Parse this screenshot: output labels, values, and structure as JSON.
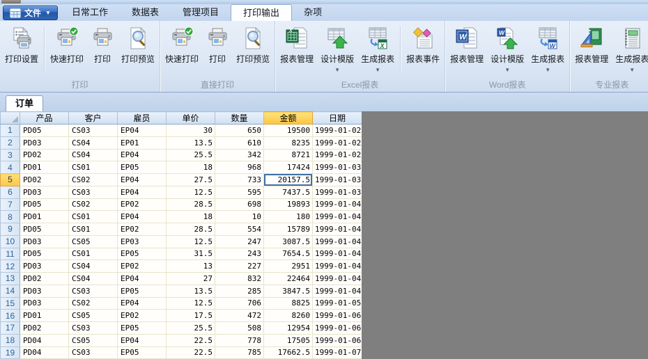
{
  "menu": {
    "file_button": {
      "label": "文件",
      "icon": "table-grid-icon",
      "caret": "▼"
    },
    "tabs": [
      {
        "name": "daily-work",
        "label": "日常工作",
        "active": false
      },
      {
        "name": "data-tables",
        "label": "数据表",
        "active": false
      },
      {
        "name": "manage-projects",
        "label": "管理项目",
        "active": false
      },
      {
        "name": "print-output",
        "label": "打印输出",
        "active": true
      },
      {
        "name": "misc",
        "label": "杂项",
        "active": false
      }
    ]
  },
  "ribbon": {
    "groups": [
      {
        "name": "print",
        "label": "打印",
        "buttons": [
          {
            "name": "print-settings",
            "label": "打印设置",
            "icon": "print-settings-icon",
            "dropdown": false,
            "divider_after": true
          },
          {
            "name": "quick-print",
            "label": "快速打印",
            "icon": "quick-print-icon",
            "dropdown": false
          },
          {
            "name": "print",
            "label": "打印",
            "icon": "print-icon",
            "dropdown": false
          },
          {
            "name": "print-preview",
            "label": "打印预览",
            "icon": "print-preview-icon",
            "dropdown": false
          }
        ]
      },
      {
        "name": "direct-print",
        "label": "直接打印",
        "buttons": [
          {
            "name": "direct-quick-print",
            "label": "快速打印",
            "icon": "quick-print-icon",
            "dropdown": false
          },
          {
            "name": "direct-print",
            "label": "打印",
            "icon": "print-icon",
            "dropdown": false
          },
          {
            "name": "direct-print-preview",
            "label": "打印预览",
            "icon": "print-preview-icon",
            "dropdown": false
          }
        ]
      },
      {
        "name": "excel-report",
        "label": "Excel报表",
        "buttons": [
          {
            "name": "excel-report-manage",
            "label": "报表管理",
            "icon": "excel-report-manage-icon",
            "dropdown": false
          },
          {
            "name": "excel-design-template",
            "label": "设计模版",
            "icon": "excel-design-template-icon",
            "dropdown": true
          },
          {
            "name": "excel-generate-report",
            "label": "生成报表",
            "icon": "excel-generate-report-icon",
            "dropdown": true,
            "divider_after": true
          },
          {
            "name": "report-event",
            "label": "报表事件",
            "icon": "report-event-icon",
            "dropdown": false
          }
        ]
      },
      {
        "name": "word-report",
        "label": "Word报表",
        "buttons": [
          {
            "name": "word-report-manage",
            "label": "报表管理",
            "icon": "word-report-manage-icon",
            "dropdown": false
          },
          {
            "name": "word-design-template",
            "label": "设计模版",
            "icon": "word-design-template-icon",
            "dropdown": true
          },
          {
            "name": "word-generate-report",
            "label": "生成报表",
            "icon": "word-generate-report-icon",
            "dropdown": true
          }
        ]
      },
      {
        "name": "pro-report",
        "label": "专业报表",
        "buttons": [
          {
            "name": "pro-report-manage",
            "label": "报表管理",
            "icon": "pro-report-manage-icon",
            "dropdown": false
          },
          {
            "name": "pro-generate-report",
            "label": "生成报表",
            "icon": "pro-generate-report-icon",
            "dropdown": true
          }
        ]
      }
    ]
  },
  "document": {
    "tab_label": "订单"
  },
  "table": {
    "columns": [
      {
        "name": "product",
        "label": "产品",
        "align": "left"
      },
      {
        "name": "customer",
        "label": "客户",
        "align": "left"
      },
      {
        "name": "employee",
        "label": "雇员",
        "align": "left"
      },
      {
        "name": "price",
        "label": "单价",
        "align": "right"
      },
      {
        "name": "qty",
        "label": "数量",
        "align": "right"
      },
      {
        "name": "amount",
        "label": "金额",
        "align": "right"
      },
      {
        "name": "date",
        "label": "日期",
        "align": "right"
      }
    ],
    "rows": [
      {
        "num": "1",
        "cells": [
          "PD05",
          "CS03",
          "EP04",
          "30",
          "650",
          "19500",
          "1999-01-02"
        ]
      },
      {
        "num": "2",
        "cells": [
          "PD03",
          "CS04",
          "EP01",
          "13.5",
          "610",
          "8235",
          "1999-01-02"
        ]
      },
      {
        "num": "3",
        "cells": [
          "PD02",
          "CS04",
          "EP04",
          "25.5",
          "342",
          "8721",
          "1999-01-02"
        ]
      },
      {
        "num": "4",
        "cells": [
          "PD01",
          "CS01",
          "EP05",
          "18",
          "968",
          "17424",
          "1999-01-03"
        ]
      },
      {
        "num": "5",
        "cells": [
          "PD02",
          "CS02",
          "EP04",
          "27.5",
          "733",
          "20157.5",
          "1999-01-03"
        ]
      },
      {
        "num": "6",
        "cells": [
          "PD03",
          "CS03",
          "EP04",
          "12.5",
          "595",
          "7437.5",
          "1999-01-03"
        ]
      },
      {
        "num": "7",
        "cells": [
          "PD05",
          "CS02",
          "EP02",
          "28.5",
          "698",
          "19893",
          "1999-01-04"
        ]
      },
      {
        "num": "8",
        "cells": [
          "PD01",
          "CS01",
          "EP04",
          "18",
          "10",
          "180",
          "1999-01-04"
        ]
      },
      {
        "num": "9",
        "cells": [
          "PD05",
          "CS01",
          "EP02",
          "28.5",
          "554",
          "15789",
          "1999-01-04"
        ]
      },
      {
        "num": "10",
        "cells": [
          "PD03",
          "CS05",
          "EP03",
          "12.5",
          "247",
          "3087.5",
          "1999-01-04"
        ]
      },
      {
        "num": "11",
        "cells": [
          "PD05",
          "CS01",
          "EP05",
          "31.5",
          "243",
          "7654.5",
          "1999-01-04"
        ]
      },
      {
        "num": "12",
        "cells": [
          "PD03",
          "CS04",
          "EP02",
          "13",
          "227",
          "2951",
          "1999-01-04"
        ]
      },
      {
        "num": "13",
        "cells": [
          "PD02",
          "CS04",
          "EP04",
          "27",
          "832",
          "22464",
          "1999-01-04"
        ]
      },
      {
        "num": "14",
        "cells": [
          "PD03",
          "CS03",
          "EP05",
          "13.5",
          "285",
          "3847.5",
          "1999-01-04"
        ]
      },
      {
        "num": "15",
        "cells": [
          "PD03",
          "CS02",
          "EP04",
          "12.5",
          "706",
          "8825",
          "1999-01-05"
        ]
      },
      {
        "num": "16",
        "cells": [
          "PD01",
          "CS05",
          "EP02",
          "17.5",
          "472",
          "8260",
          "1999-01-06"
        ]
      },
      {
        "num": "17",
        "cells": [
          "PD02",
          "CS03",
          "EP05",
          "25.5",
          "508",
          "12954",
          "1999-01-06"
        ]
      },
      {
        "num": "18",
        "cells": [
          "PD04",
          "CS05",
          "EP04",
          "22.5",
          "778",
          "17505",
          "1999-01-06"
        ]
      },
      {
        "num": "19",
        "cells": [
          "PD04",
          "CS03",
          "EP05",
          "22.5",
          "785",
          "17662.5",
          "1999-01-07"
        ]
      }
    ],
    "selection": {
      "row_num": "5",
      "column": "amount",
      "value": "20157.5"
    }
  },
  "colors": {
    "selection_yellow": "#FBC84E",
    "column_header_blue": "#D3E1F2",
    "row_number_blue": "#2D6398",
    "grid_line_tan": "#E9E3CC",
    "empty_area_gray": "#7F7F7F",
    "file_button_blue": "#2E66B6",
    "selected_cell_border": "#3F6FA5",
    "ribbon_background": "#DDE8F5"
  }
}
